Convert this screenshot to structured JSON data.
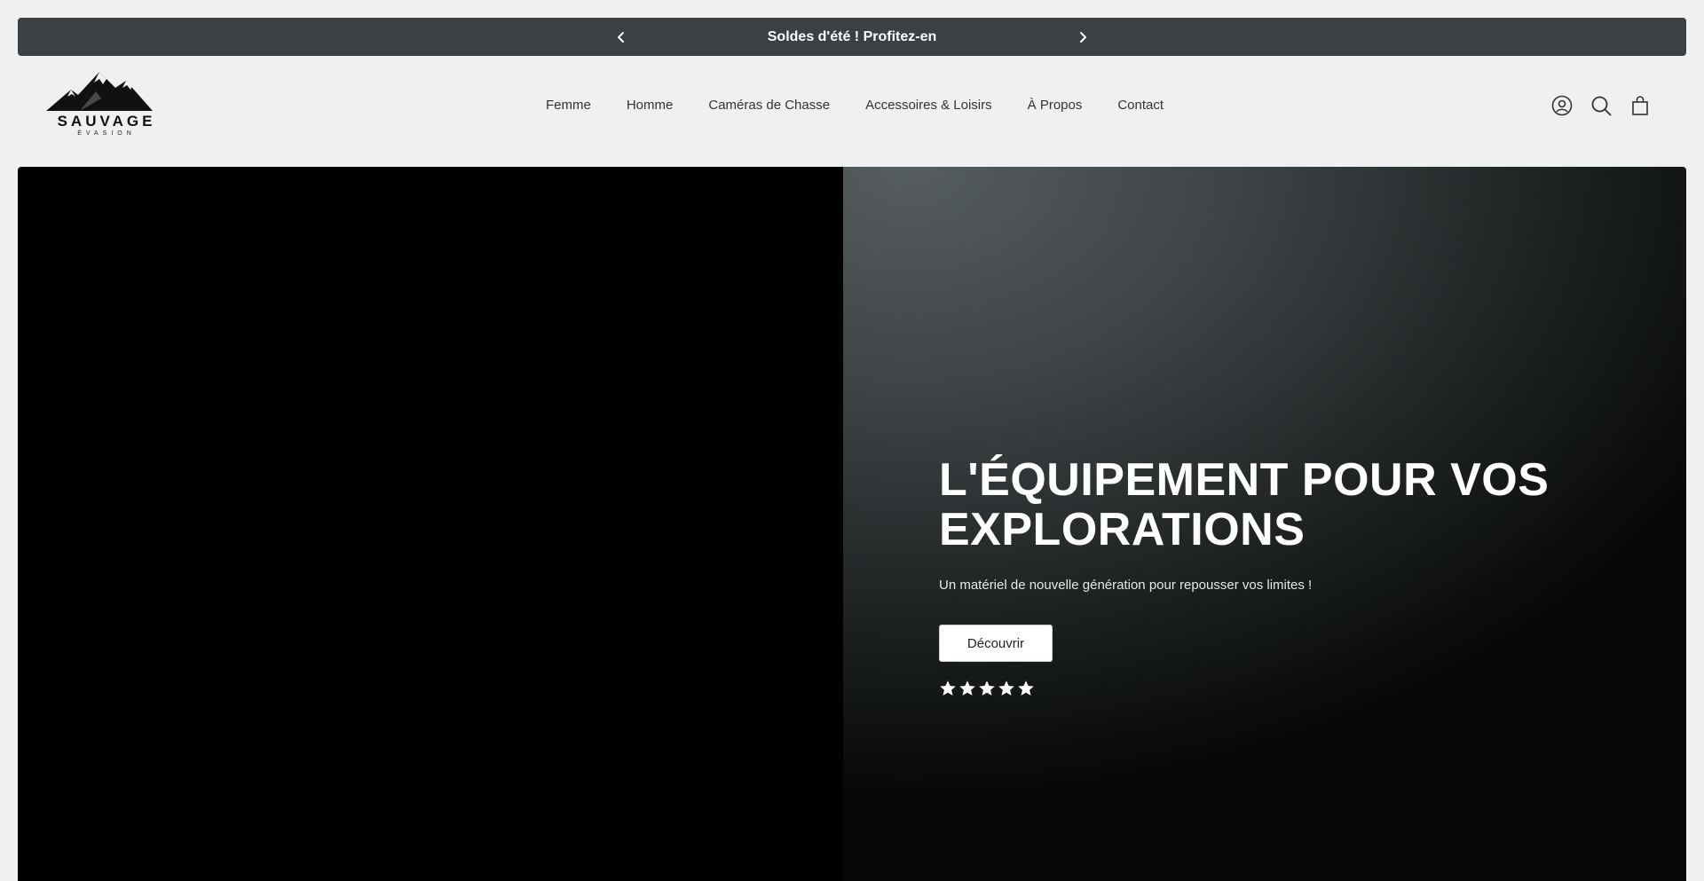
{
  "announcement": {
    "message": "Soldes d'été ! Profitez-en",
    "prev_icon": "chevron-left-icon",
    "next_icon": "chevron-right-icon"
  },
  "header": {
    "logo": {
      "brand": "SAUVAGE",
      "sub": "ÉVASION",
      "icon": "mountain-logo-icon"
    },
    "nav": [
      {
        "label": "Femme"
      },
      {
        "label": "Homme"
      },
      {
        "label": "Caméras de Chasse"
      },
      {
        "label": "Accessoires & Loisirs"
      },
      {
        "label": "À Propos"
      },
      {
        "label": "Contact"
      }
    ],
    "icons": [
      "account-icon",
      "search-icon",
      "cart-icon"
    ]
  },
  "hero": {
    "title_line1": "L'ÉQUIPEMENT POUR VOS",
    "title_line2": "EXPLORATIONS",
    "subtitle": "Un matériel de nouvelle génération pour repousser vos limites !",
    "cta_label": "Découvrir",
    "rating": 5,
    "rating_max": 5
  },
  "colors": {
    "announcement_bg": "#3c4043",
    "page_bg": "#f0f0f0",
    "hero_left_bg": "#000000",
    "hero_text": "#ffffff"
  }
}
